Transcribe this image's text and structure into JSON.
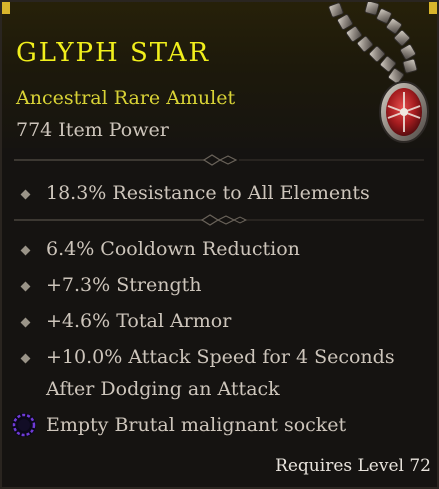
{
  "item": {
    "name": "GLYPH STAR",
    "type": "Ancestral Rare Amulet",
    "item_power": "774 Item Power"
  },
  "implicit_affixes": [
    {
      "text": "18.3% Resistance to All Elements"
    }
  ],
  "affixes": [
    {
      "text": "6.4% Cooldown Reduction"
    },
    {
      "text": "+7.3% Strength"
    },
    {
      "text": "+4.6% Total Armor"
    },
    {
      "line1": "+10.0% Attack Speed for 4 Seconds",
      "line2": "After Dodging an Attack"
    }
  ],
  "socket": {
    "text": "Empty Brutal malignant socket",
    "icon": "malignant-socket-icon"
  },
  "requirement": "Requires Level 72",
  "colors": {
    "name": "#f1ef1c",
    "type": "#d9d336",
    "body_text": "#cdc5bb",
    "socket_ring": "#6f3bd6"
  }
}
